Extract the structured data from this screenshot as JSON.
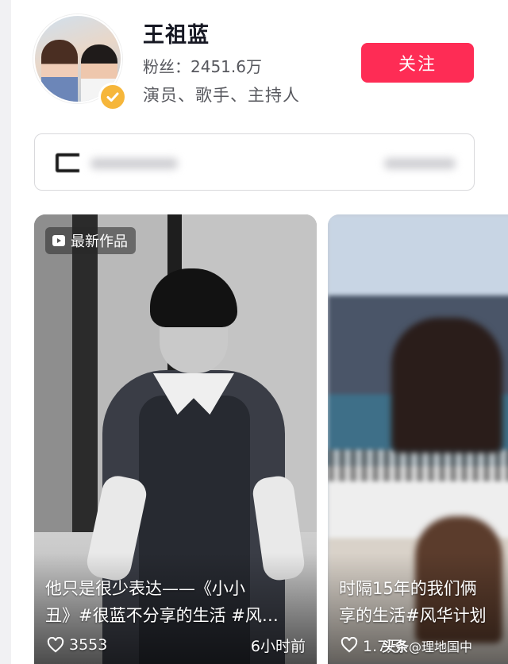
{
  "profile": {
    "name": "王祖蓝",
    "fans": "粉丝：2451.6万",
    "roles": "演员、歌手、主持人"
  },
  "actions": {
    "follow_label": "关注"
  },
  "cards": [
    {
      "badge": "最新作品",
      "caption_line1": "他只是很少表达——《小小",
      "caption_line2": "丑》#很蓝不分享的生活 #风…",
      "likes": "3553",
      "time": "6小时前"
    },
    {
      "caption_line1": "时隔15年的我们俩",
      "caption_line2": "享的生活#风华计划",
      "likes": "1.7万"
    }
  ],
  "watermark": {
    "brand": "头条",
    "handle": "@理地国中"
  },
  "icons": {
    "verify": "verified-check-icon",
    "video": "video-play-icon",
    "like": "heart-outline-icon"
  },
  "colors": {
    "accent": "#fe2c55",
    "verify": "#f6b63a"
  }
}
